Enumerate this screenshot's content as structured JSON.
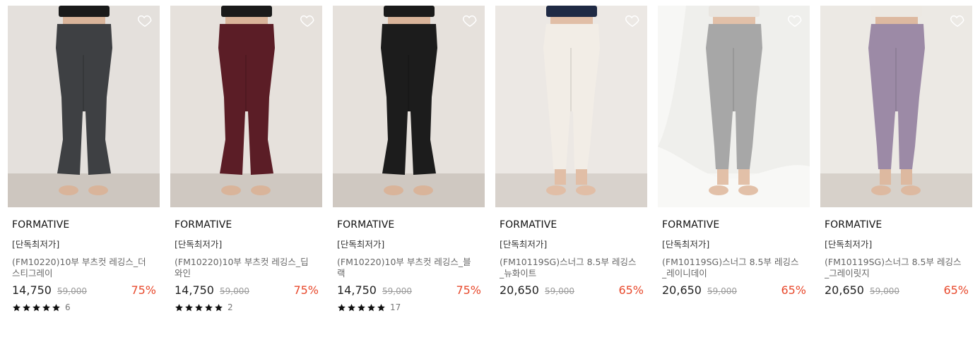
{
  "products": [
    {
      "brand": "FORMATIVE",
      "badge": "[단독최저가]",
      "name": "(FM10220)10부 부츠컷 레깅스_더스티그레이",
      "price": "14,750",
      "original_price": "59,000",
      "discount": "75%",
      "rating_count": "6",
      "stars": 5,
      "image": {
        "bg": "#e4e0dc",
        "floor": "#cdc6bf",
        "pants": "#3e4043",
        "top": "#1a1a1a",
        "skin": "#d9b49a",
        "cut": "bootcut",
        "cloth": false
      }
    },
    {
      "brand": "FORMATIVE",
      "badge": "[단독최저가]",
      "name": "(FM10220)10부 부츠컷 레깅스_딥와인",
      "price": "14,750",
      "original_price": "59,000",
      "discount": "75%",
      "rating_count": "2",
      "stars": 5,
      "image": {
        "bg": "#e6e1dc",
        "floor": "#cfc8c1",
        "pants": "#5b1d26",
        "top": "#1a1a1a",
        "skin": "#d9b49a",
        "cut": "bootcut",
        "cloth": false
      }
    },
    {
      "brand": "FORMATIVE",
      "badge": "[단독최저가]",
      "name": "(FM10220)10부 부츠컷 레깅스_블랙",
      "price": "14,750",
      "original_price": "59,000",
      "discount": "75%",
      "rating_count": "17",
      "stars": 5,
      "image": {
        "bg": "#e6e1dc",
        "floor": "#cfc8c1",
        "pants": "#1c1c1c",
        "top": "#1a1a1a",
        "skin": "#d9b49a",
        "cut": "bootcut",
        "cloth": false
      }
    },
    {
      "brand": "FORMATIVE",
      "badge": "[단독최저가]",
      "name": "(FM10119SG)스너그 8.5부 레깅스_뉴화이트",
      "price": "20,650",
      "original_price": "59,000",
      "discount": "65%",
      "rating_count": "",
      "stars": 0,
      "image": {
        "bg": "#ece8e4",
        "floor": "#d8d2cc",
        "pants": "#f2ede6",
        "top": "#1f2a44",
        "skin": "#e1bea6",
        "cut": "cropped",
        "cloth": false
      }
    },
    {
      "brand": "FORMATIVE",
      "badge": "[단독최저가]",
      "name": "(FM10119SG)스너그 8.5부 레깅스_레이니데이",
      "price": "20,650",
      "original_price": "59,000",
      "discount": "65%",
      "rating_count": "",
      "stars": 0,
      "image": {
        "bg": "#efefec",
        "floor": "#f6f6f4",
        "pants": "#a7a7a7",
        "top": "#e9e6e1",
        "skin": "#e2c0a8",
        "cut": "cropped",
        "cloth": true
      }
    },
    {
      "brand": "FORMATIVE",
      "badge": "[단독최저가]",
      "name": "(FM10119SG)스너그 8.5부 레깅스_그레이릿지",
      "price": "20,650",
      "original_price": "59,000",
      "discount": "65%",
      "rating_count": "",
      "stars": 0,
      "image": {
        "bg": "#ece9e4",
        "floor": "#d7d1ca",
        "pants": "#9c8aa6",
        "top": "#ece8e2",
        "skin": "#ddb9a0",
        "cut": "cropped",
        "cloth": false
      }
    }
  ],
  "colors": {
    "discount": "#e8492c",
    "star": "#111111"
  },
  "icons": {
    "wishlist": "heart-outline-icon",
    "rating": "star-icon"
  }
}
